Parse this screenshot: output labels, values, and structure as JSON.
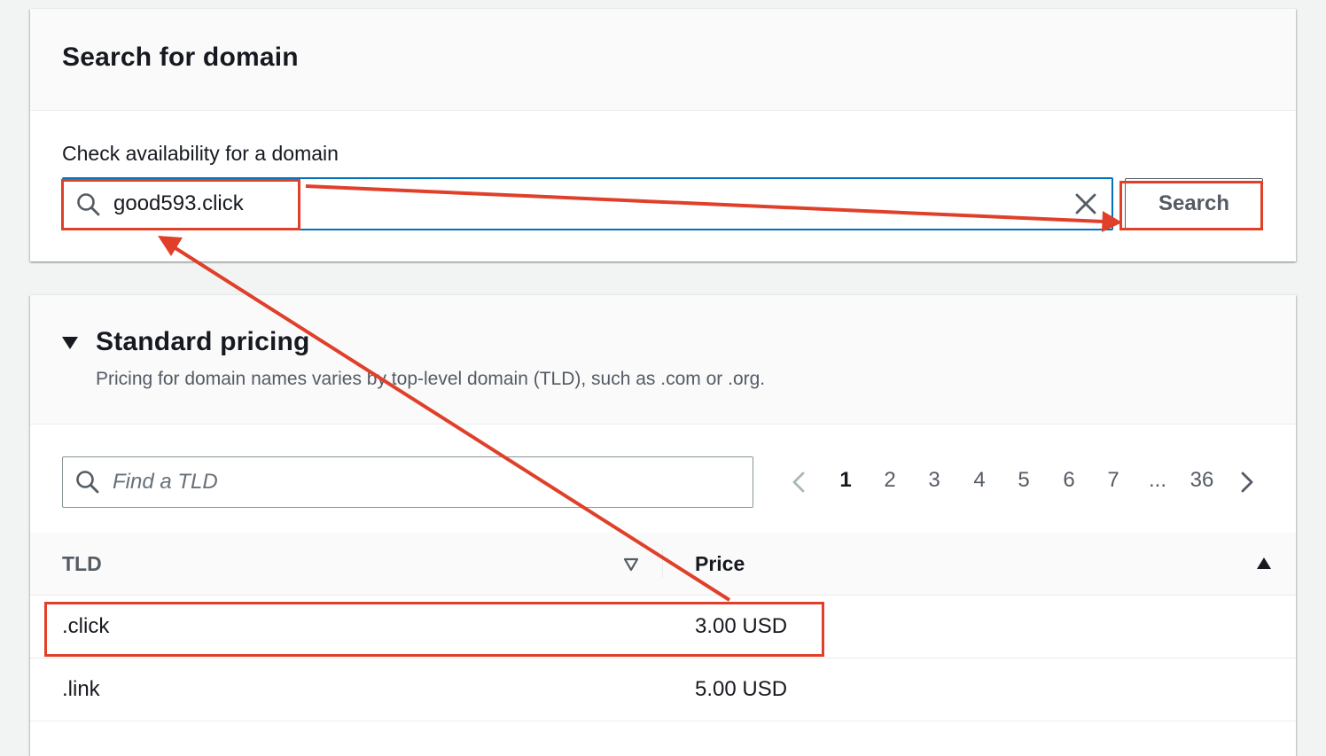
{
  "search_panel": {
    "title": "Search for domain",
    "field_label": "Check availability for a domain",
    "domain_value": "good593.click",
    "search_button_label": "Search"
  },
  "pricing_panel": {
    "title": "Standard pricing",
    "description": "Pricing for domain names varies by top-level domain (TLD), such as .com or .org.",
    "filter_placeholder": "Find a TLD",
    "pagination": {
      "pages": [
        "1",
        "2",
        "3",
        "4",
        "5",
        "6",
        "7",
        "...",
        "36"
      ],
      "current": "1"
    },
    "columns": [
      "TLD",
      "Price"
    ],
    "rows": [
      {
        "tld": ".click",
        "price": "3.00 USD"
      },
      {
        "tld": ".link",
        "price": "5.00 USD"
      }
    ]
  },
  "colors": {
    "annotation": "#e0402a",
    "focus_border": "#0073bb",
    "background": "#f2f3f3"
  },
  "icons": [
    "search-icon",
    "clear-icon",
    "caret-down-icon",
    "chevron-left-icon",
    "chevron-right-icon",
    "sort-descending-icon",
    "sort-ascending-icon"
  ]
}
